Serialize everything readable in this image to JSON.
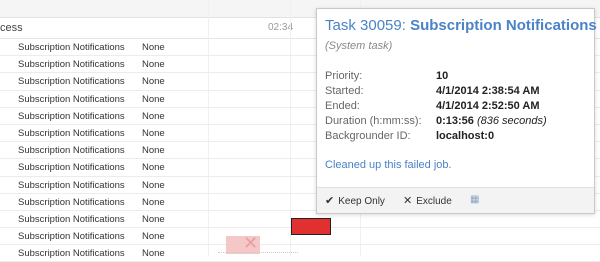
{
  "header": {
    "title": "cess",
    "time": "02:34"
  },
  "rows": [
    {
      "task": "Subscription Notifications",
      "status": "None"
    },
    {
      "task": "Subscription Notifications",
      "status": "None"
    },
    {
      "task": "Subscription Notifications",
      "status": "None"
    },
    {
      "task": "Subscription Notifications",
      "status": "None"
    },
    {
      "task": "Subscription Notifications",
      "status": "None"
    },
    {
      "task": "Subscription Notifications",
      "status": "None"
    },
    {
      "task": "Subscription Notifications",
      "status": "None"
    },
    {
      "task": "Subscription Notifications",
      "status": "None"
    },
    {
      "task": "Subscription Notifications",
      "status": "None"
    },
    {
      "task": "Subscription Notifications",
      "status": "None"
    },
    {
      "task": "Subscription Notifications",
      "status": "None"
    },
    {
      "task": "Subscription Notifications",
      "status": "None"
    },
    {
      "task": "Subscription Notifications",
      "status": "None"
    }
  ],
  "tooltip": {
    "title_prefix": "Task 30059: ",
    "title_name": "Subscription Notifications",
    "subtitle": "(System task)",
    "fields": {
      "priority": {
        "label": "Priority:",
        "value": "10"
      },
      "started": {
        "label": "Started:",
        "value": "4/1/2014 2:38:54 AM"
      },
      "ended": {
        "label": "Ended:",
        "value": "4/1/2014 2:52:50 AM"
      },
      "duration": {
        "label": "Duration (h:mm:ss):",
        "value": "0:13:56",
        "seconds": "(836 seconds)"
      },
      "backgrounder": {
        "label": "Backgrounder ID:",
        "value": "localhost:0"
      }
    },
    "message": "Cleaned up this failed job.",
    "actions": {
      "keep_only": {
        "label": "Keep Only",
        "icon": "check-icon"
      },
      "exclude": {
        "label": "Exclude",
        "icon": "x-icon"
      },
      "view_data": {
        "icon": "grid-icon"
      }
    }
  },
  "colors": {
    "accent": "#4a83c6",
    "failed_bar": "#e03030"
  }
}
